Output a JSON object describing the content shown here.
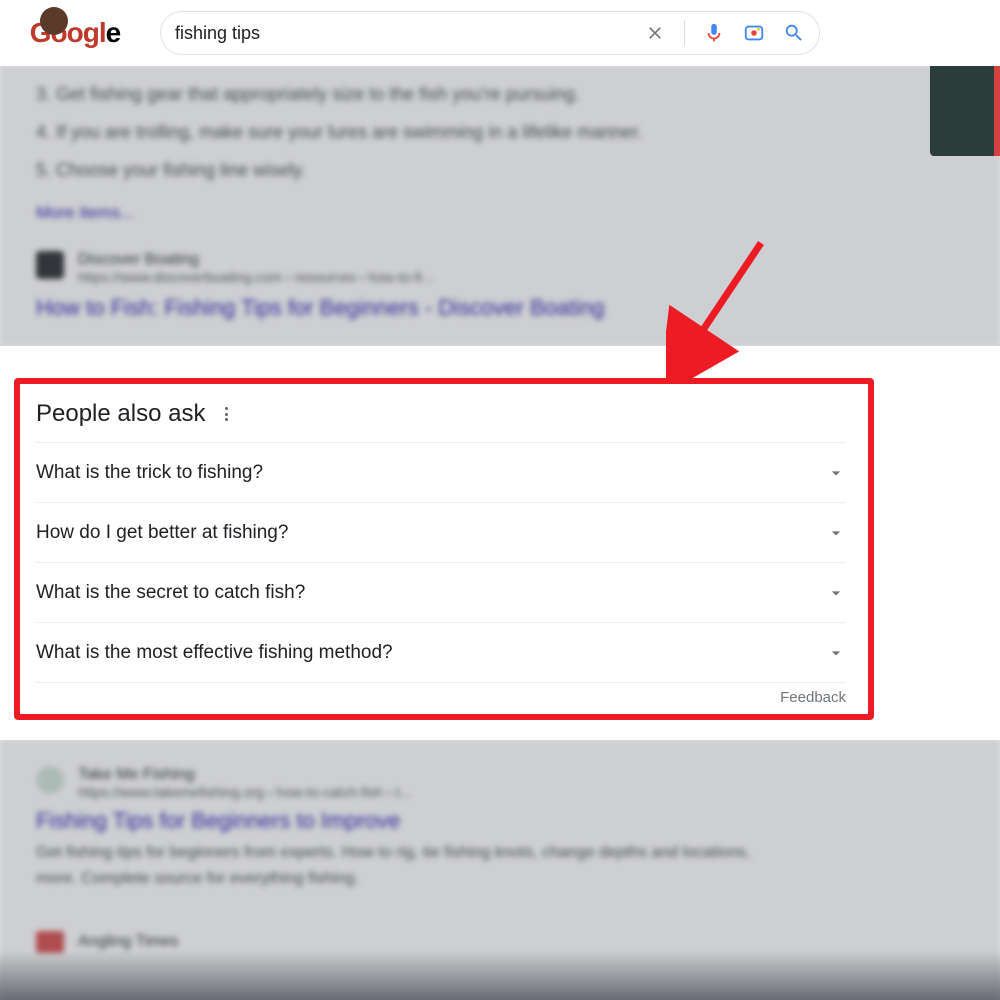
{
  "logo_text": "Google",
  "search": {
    "query": "fishing tips",
    "placeholder": ""
  },
  "blurred_top": {
    "list": {
      "item3_num": "3.",
      "item3": "Get fishing gear that appropriately size to the fish you're pursuing.",
      "item4_num": "4.",
      "item4": "If you are trolling, make sure your lures are swimming in a lifelike manner.",
      "item5_num": "5.",
      "item5": "Choose your fishing line wisely."
    },
    "more": "More items...",
    "source_name": "Discover Boating",
    "source_url": "https://www.discoverboating.com › resources › how-to-fi...",
    "title": "How to Fish: Fishing Tips for Beginners - Discover Boating"
  },
  "paa": {
    "heading": "People also ask",
    "items": [
      "What is the trick to fishing?",
      "How do I get better at fishing?",
      "What is the secret to catch fish?",
      "What is the most effective fishing method?"
    ],
    "feedback": "Feedback"
  },
  "blurred_bottom": {
    "source_name": "Take Me Fishing",
    "source_url": "https://www.takemefishing.org › how-to-catch-fish › t...",
    "title": "Fishing Tips for Beginners to Improve",
    "snippet": "Get fishing tips for beginners from experts. How to rig, tie fishing knots, change depths and locations, more. Complete source for everything fishing.",
    "next_source": "Angling Times"
  }
}
